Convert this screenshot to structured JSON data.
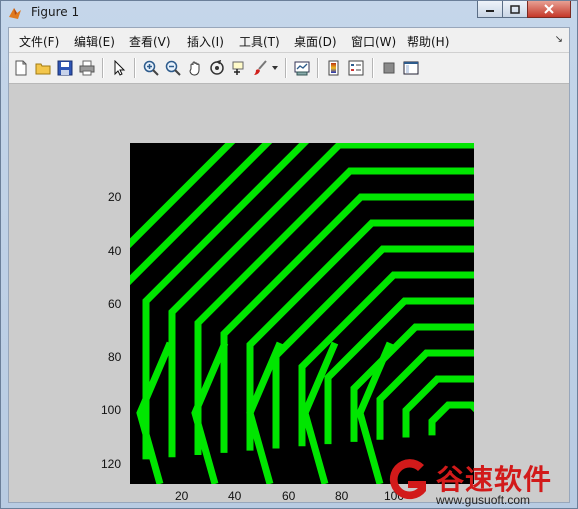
{
  "window": {
    "title": "Figure 1"
  },
  "menu": [
    {
      "label": "文件(F)"
    },
    {
      "label": "编辑(E)"
    },
    {
      "label": "查看(V)"
    },
    {
      "label": "插入(I)"
    },
    {
      "label": "工具(T)"
    },
    {
      "label": "桌面(D)"
    },
    {
      "label": "窗口(W)"
    },
    {
      "label": "帮助(H)"
    }
  ],
  "toolbar_icons": [
    "new-figure-icon",
    "open-file-icon",
    "save-icon",
    "print-icon",
    "pointer-icon",
    "zoom-in-icon",
    "zoom-out-icon",
    "pan-icon",
    "rotate-3d-icon",
    "data-cursor-icon",
    "brush-icon",
    "brush-dropdown-icon",
    "link-plot-icon",
    "colorbar-icon",
    "legend-icon",
    "hide-plot-tools-icon",
    "show-plot-tools-icon"
  ],
  "colors": {
    "plot_background": "#000000",
    "stripe": "#00e600",
    "figure_background": "#cccccc"
  },
  "plot": {
    "y_ticks": [
      "20",
      "40",
      "60",
      "80",
      "100",
      "120"
    ],
    "x_ticks": [
      "20",
      "40",
      "60",
      "80",
      "100"
    ],
    "x_range": [
      0.5,
      128.5
    ],
    "y_range": [
      0.5,
      128.5
    ],
    "colormap": "green"
  },
  "watermark": {
    "brand": "谷速软件",
    "url": "www.gusuoft.com"
  }
}
